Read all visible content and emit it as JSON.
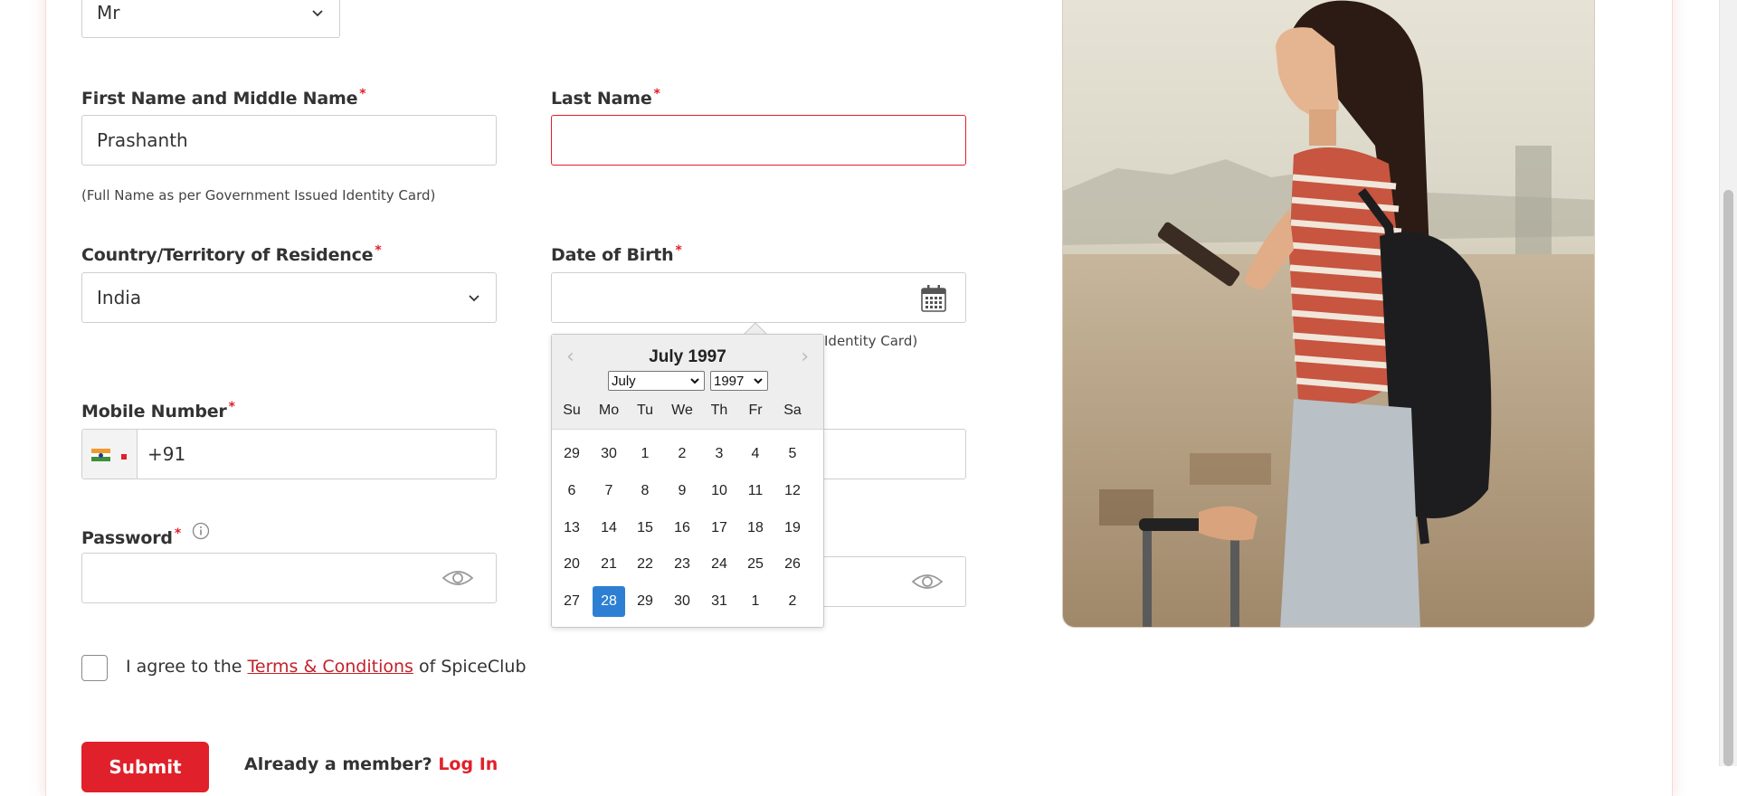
{
  "form": {
    "title_value": "Mr",
    "first_name_label": "First Name and Middle Name",
    "first_name_value": "Prashanth",
    "first_name_hint": "(Full Name as per Government Issued Identity Card)",
    "last_name_label": "Last Name",
    "last_name_value": "",
    "country_label": "Country/Territory of Residence",
    "country_value": "India",
    "dob_label": "Date of Birth",
    "dob_value": "",
    "dob_hint_partial": "Identity Card)",
    "mobile_label": "Mobile Number",
    "mobile_value": "+91",
    "password_label": "Password",
    "required_mark": "*",
    "agree_prefix": "I agree to the ",
    "terms_link": "Terms & Conditions",
    "agree_suffix": " of SpiceClub",
    "submit_label": "Submit",
    "already_member": "Already a member? ",
    "login_link": "Log In"
  },
  "datepicker": {
    "title": "July 1997",
    "month_select": "July",
    "year_select": "1997",
    "weekdays": [
      "Su",
      "Mo",
      "Tu",
      "We",
      "Th",
      "Fr",
      "Sa"
    ],
    "weeks": [
      [
        "29",
        "30",
        "1",
        "2",
        "3",
        "4",
        "5"
      ],
      [
        "6",
        "7",
        "8",
        "9",
        "10",
        "11",
        "12"
      ],
      [
        "13",
        "14",
        "15",
        "16",
        "17",
        "18",
        "19"
      ],
      [
        "20",
        "21",
        "22",
        "23",
        "24",
        "25",
        "26"
      ],
      [
        "27",
        "28",
        "29",
        "30",
        "31",
        "1",
        "2"
      ]
    ],
    "selected_day": "28"
  },
  "colors": {
    "accent": "#e0202a",
    "selected_day": "#2d7fd4"
  }
}
